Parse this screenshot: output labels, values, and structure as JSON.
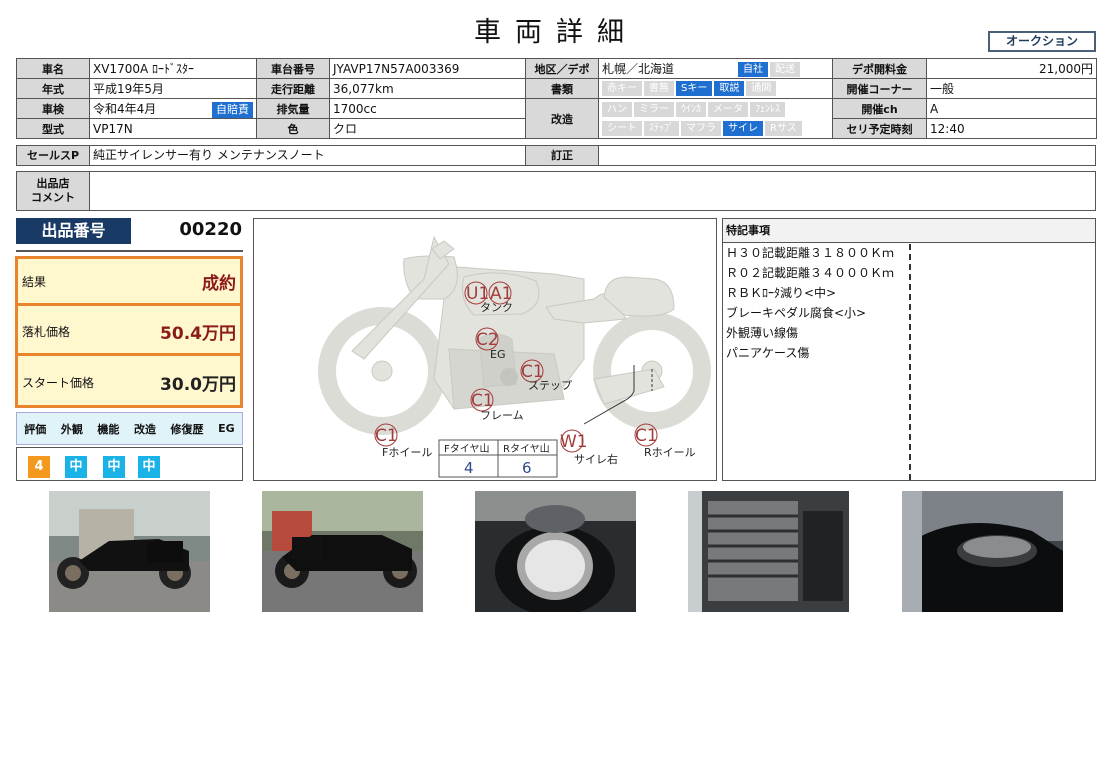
{
  "page_title": "車両詳細",
  "auction_badge": "オークション",
  "rows": {
    "r1": {
      "l1": "車名",
      "v1": "XV1700A ﾛｰﾄﾞｽﾀｰ",
      "l2": "車台番号",
      "v2": "JYAVP17N57A003369",
      "l3": "地区／デポ",
      "v3": "札幌／北海道",
      "l4": "デポ開料金",
      "v4": "21,000円"
    },
    "r2": {
      "l1": "年式",
      "v1": "平成19年5月",
      "l2": "走行距離",
      "v2": "36,077km",
      "l3": "書類",
      "l4": "開催コーナー",
      "v4": "一般"
    },
    "r3": {
      "l1": "車検",
      "v1": "令和4年4月",
      "jibai": "自賠責",
      "l2": "排気量",
      "v2": "1700cc",
      "l3": "改造",
      "l4": "開催ch",
      "v4": "A"
    },
    "r4": {
      "l1": "型式",
      "v1": "VP17N",
      "l2": "色",
      "v2": "クロ",
      "l4": "セリ予定時刻",
      "v4": "12:40"
    }
  },
  "chips": {
    "region": [
      {
        "label": "自社",
        "on": true
      },
      {
        "label": "配送",
        "on": false
      }
    ],
    "docs": [
      {
        "label": "赤キー",
        "on": false
      },
      {
        "label": "書無",
        "on": false
      },
      {
        "label": "Sキー",
        "on": true
      },
      {
        "label": "取説",
        "on": true
      },
      {
        "label": "通関",
        "on": false
      }
    ],
    "mods1": [
      {
        "label": "ハン",
        "on": false
      },
      {
        "label": "ミラー",
        "on": false
      },
      {
        "label": "ｳｲﾝｶ",
        "on": false
      },
      {
        "label": "メータ",
        "on": false
      },
      {
        "label": "ﾌｪﾝﾚｽ",
        "on": false
      }
    ],
    "mods2": [
      {
        "label": "シート",
        "on": false
      },
      {
        "label": "ｽﾃｯﾌﾟ",
        "on": false
      },
      {
        "label": "マフラ",
        "on": false
      },
      {
        "label": "サイレ",
        "on": true
      },
      {
        "label": "Rサス",
        "on": false
      }
    ]
  },
  "sales": {
    "label": "セールスP",
    "value": "純正サイレンサー有り メンテナンスノート",
    "correction_label": "訂正",
    "correction_value": ""
  },
  "comment": {
    "label1": "出品店",
    "label2": "コメント",
    "value": ""
  },
  "lot": {
    "label": "出品番号",
    "number": "00220"
  },
  "result": {
    "result_label": "結果",
    "result_value": "成約",
    "winning_label": "落札価格",
    "winning_value": "50.4万円",
    "start_label": "スタート価格",
    "start_value": "30.0万円"
  },
  "evaluation": {
    "headers": [
      "評価",
      "外観",
      "機能",
      "改造",
      "修復歴",
      "EG"
    ],
    "values": [
      {
        "text": "4",
        "color": "#f39a1e"
      },
      {
        "text": "中",
        "color": "#1ab3e8"
      },
      {
        "text": "中",
        "color": "#1ab3e8"
      },
      {
        "text": "中",
        "color": "#1ab3e8"
      }
    ]
  },
  "diagram": {
    "labels": {
      "tank": "タンク",
      "eg": "EG",
      "step": "ステップ",
      "frame": "フレーム",
      "f_wheel": "Fホイール",
      "r_wheel": "Rホイール",
      "silencer": "サイレ右"
    },
    "marks": {
      "u1": "U1",
      "a1": "A1",
      "c2": "C2",
      "c1_step": "C1",
      "c1_frame": "C1",
      "c1_fw": "C1",
      "c1_rw": "C1",
      "w1": "W1"
    },
    "tire_f_label": "Fタイヤ山",
    "tire_f_value": "4",
    "tire_r_label": "Rタイヤ山",
    "tire_r_value": "6"
  },
  "notes": {
    "title": "特記事項",
    "items": [
      "Ｈ３０記載距離３１８００Ｋｍ",
      "Ｒ０２記載距離３４０００Ｋｍ",
      "ＲＢＫﾛｰﾀ減り<中>",
      "ブレーキペダル腐食<小>",
      "外観薄い線傷",
      "パニアケース傷"
    ]
  }
}
